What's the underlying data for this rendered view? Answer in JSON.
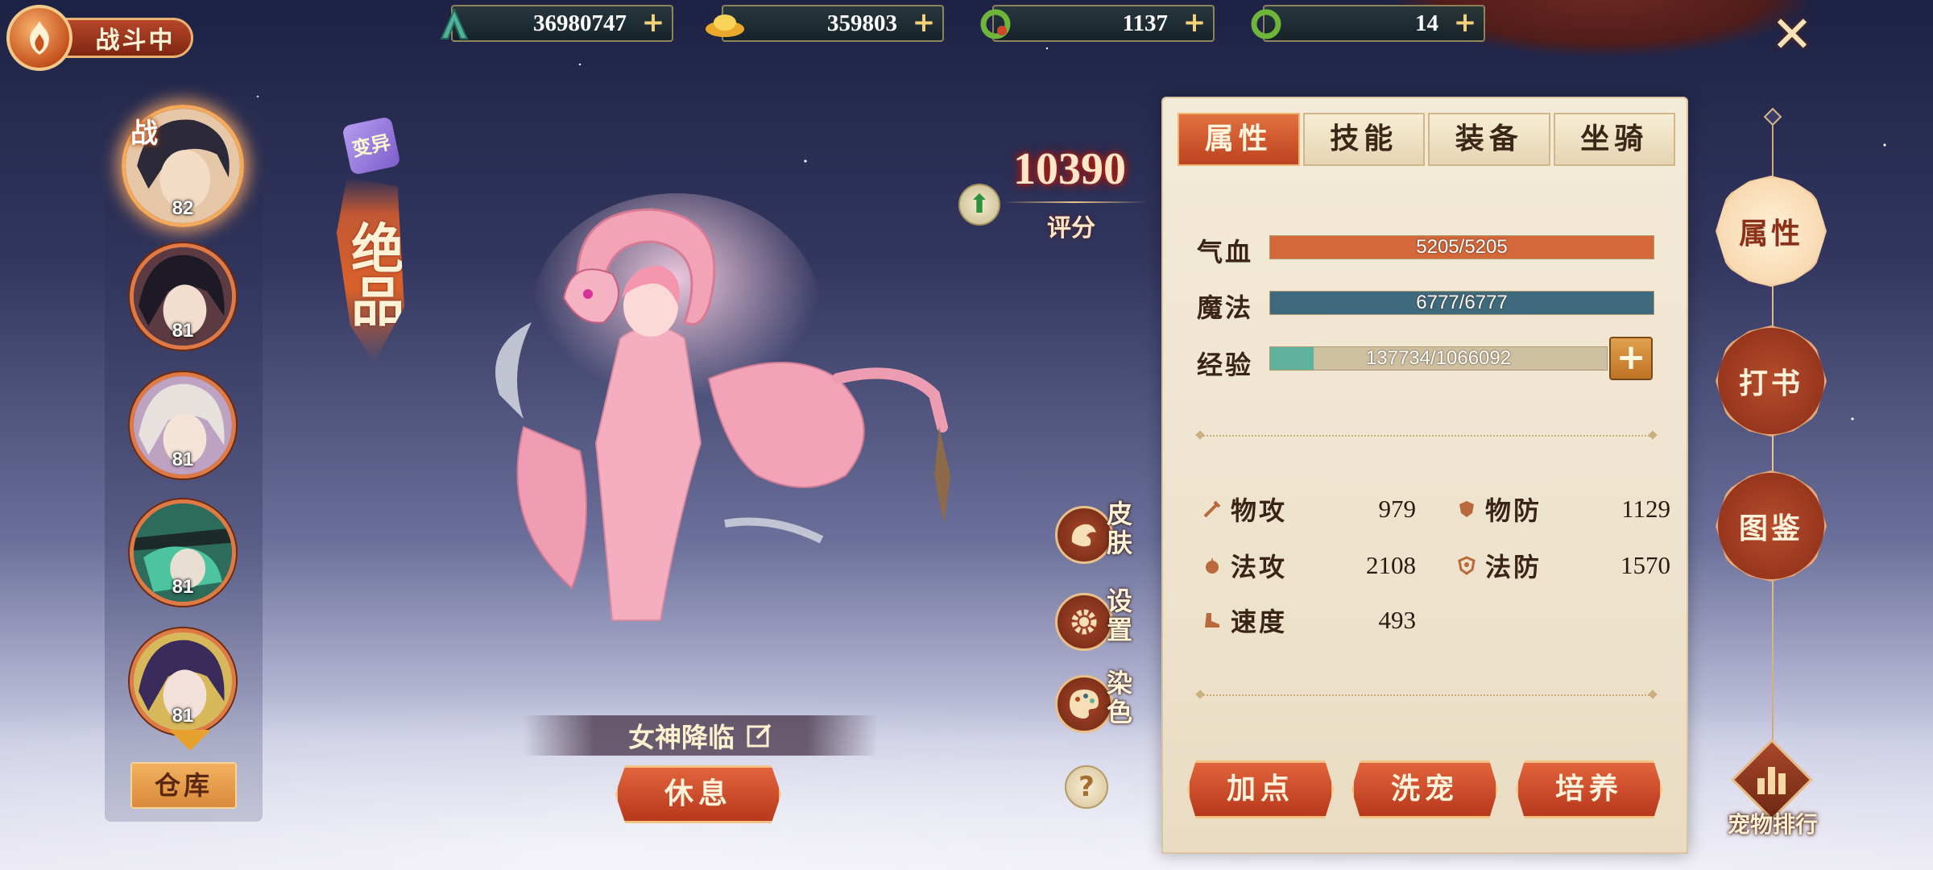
{
  "top_bar": {
    "battle_status": "战斗中",
    "currencies": [
      {
        "icon": "jade-token-icon",
        "value": "36980747",
        "color": "#49a591"
      },
      {
        "icon": "gold-ingot-icon",
        "value": "359803",
        "color": "#f1c13a"
      },
      {
        "icon": "green-dragon-ring-icon",
        "value": "1137",
        "color": "#7ec24a"
      },
      {
        "icon": "green-dragon-ring-icon",
        "value": "14",
        "color": "#7ec24a"
      }
    ],
    "plus_label": "+",
    "close_icon": "close-icon"
  },
  "roster": {
    "battle_tag": "战",
    "pets": [
      {
        "level": "82",
        "active": true
      },
      {
        "level": "81",
        "active": false
      },
      {
        "level": "81",
        "active": false
      },
      {
        "level": "81",
        "active": false
      },
      {
        "level": "81",
        "active": false
      }
    ],
    "warehouse_label": "仓库"
  },
  "pet": {
    "mutate_tag": "变异",
    "quality": "绝品",
    "score_value": "10390",
    "score_label": "评分",
    "name": "女神降临",
    "rest_label": "休息"
  },
  "side_actions": [
    {
      "label": "皮肤",
      "icon": "skin-icon"
    },
    {
      "label": "设置",
      "icon": "gear-icon"
    },
    {
      "label": "染色",
      "icon": "palette-icon"
    }
  ],
  "help_label": "?",
  "panel": {
    "tabs": [
      {
        "label": "属性",
        "active": true
      },
      {
        "label": "技能",
        "active": false
      },
      {
        "label": "装备",
        "active": false
      },
      {
        "label": "坐骑",
        "active": false
      }
    ],
    "hp": {
      "label": "气血",
      "text": "5205/5205",
      "fraction": 1.0,
      "color": "#d4683a"
    },
    "mp": {
      "label": "魔法",
      "text": "6777/6777",
      "fraction": 1.0,
      "color": "#3f6a7d"
    },
    "exp": {
      "label": "经验",
      "text": "137734/1066092",
      "fraction": 0.129,
      "color": "#5fb39c"
    },
    "exp_plus": "+",
    "attributes": {
      "phys_atk": {
        "label": "物攻",
        "value": "979"
      },
      "phys_def": {
        "label": "物防",
        "value": "1129"
      },
      "mag_atk": {
        "label": "法攻",
        "value": "2108"
      },
      "mag_def": {
        "label": "法防",
        "value": "1570"
      },
      "speed": {
        "label": "速度",
        "value": "493"
      }
    },
    "buttons": {
      "add_points": "加点",
      "wash": "洗宠",
      "cultivate": "培养"
    }
  },
  "right_nav": {
    "items": [
      {
        "label": "属性",
        "active": true
      },
      {
        "label": "打书",
        "active": false
      },
      {
        "label": "图鉴",
        "active": false
      }
    ],
    "ranking_label": "宠物排行"
  }
}
